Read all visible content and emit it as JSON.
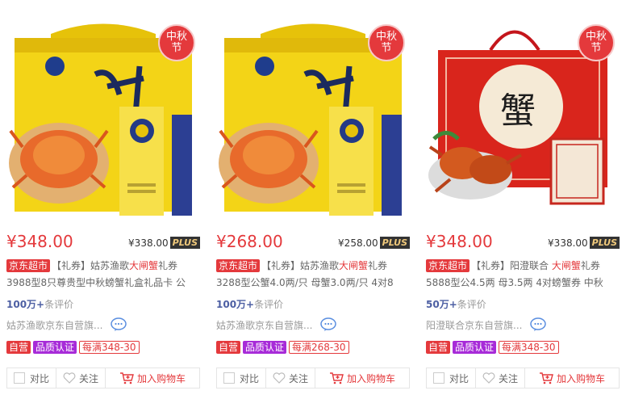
{
  "colors": {
    "accent": "#e4393c",
    "quality": "#a72bd8",
    "plus_bg": "#333333",
    "plus_text": "#f0c97b",
    "link_blue": "#4d5fa3"
  },
  "products": [
    {
      "badge_line1": "中秋",
      "badge_line2": "节",
      "price": "¥348.00",
      "plus_price": "¥338.00",
      "plus_label": "PLUS",
      "jd_tag": "京东超市",
      "title_prefix": "【礼券】姑苏渔歌",
      "title_highlight": "大闸蟹",
      "title_suffix": "礼券3988型8只尊贵型中秋螃蟹礼盒礼品卡 公",
      "comment_count": "100万+",
      "comment_label": "条评价",
      "shop": "姑苏渔歌京东自营旗...",
      "tag_self": "自营",
      "tag_quality": "品质认证",
      "tag_promo": "每满348-30",
      "compare_label": "对比",
      "fav_label": "关注",
      "cart_label": "加入购物车",
      "image_icon": "crab-gift-box-yellow"
    },
    {
      "badge_line1": "中秋",
      "badge_line2": "节",
      "price": "¥268.00",
      "plus_price": "¥258.00",
      "plus_label": "PLUS",
      "jd_tag": "京东超市",
      "title_prefix": "【礼券】姑苏渔歌",
      "title_highlight": "大闸蟹",
      "title_suffix": "礼券3288型公蟹4.0两/只 母蟹3.0两/只 4对8",
      "comment_count": "100万+",
      "comment_label": "条评价",
      "shop": "姑苏渔歌京东自营旗...",
      "tag_self": "自营",
      "tag_quality": "品质认证",
      "tag_promo": "每满268-30",
      "compare_label": "对比",
      "fav_label": "关注",
      "cart_label": "加入购物车",
      "image_icon": "crab-gift-box-yellow"
    },
    {
      "badge_line1": "中秋",
      "badge_line2": "节",
      "price": "¥348.00",
      "plus_price": "¥338.00",
      "plus_label": "PLUS",
      "jd_tag": "京东超市",
      "title_prefix": "【礼券】阳澄联合 ",
      "title_highlight": "大闸蟹",
      "title_suffix": "礼券5888型公4.5两 母3.5两 4对螃蟹券 中秋",
      "comment_count": "50万+",
      "comment_label": "条评价",
      "shop": "阳澄联合京东自营旗...",
      "tag_self": "自营",
      "tag_quality": "品质认证",
      "tag_promo": "每满348-30",
      "compare_label": "对比",
      "fav_label": "关注",
      "cart_label": "加入购物车",
      "image_icon": "crab-gift-box-red",
      "image_text": "蟹"
    }
  ]
}
